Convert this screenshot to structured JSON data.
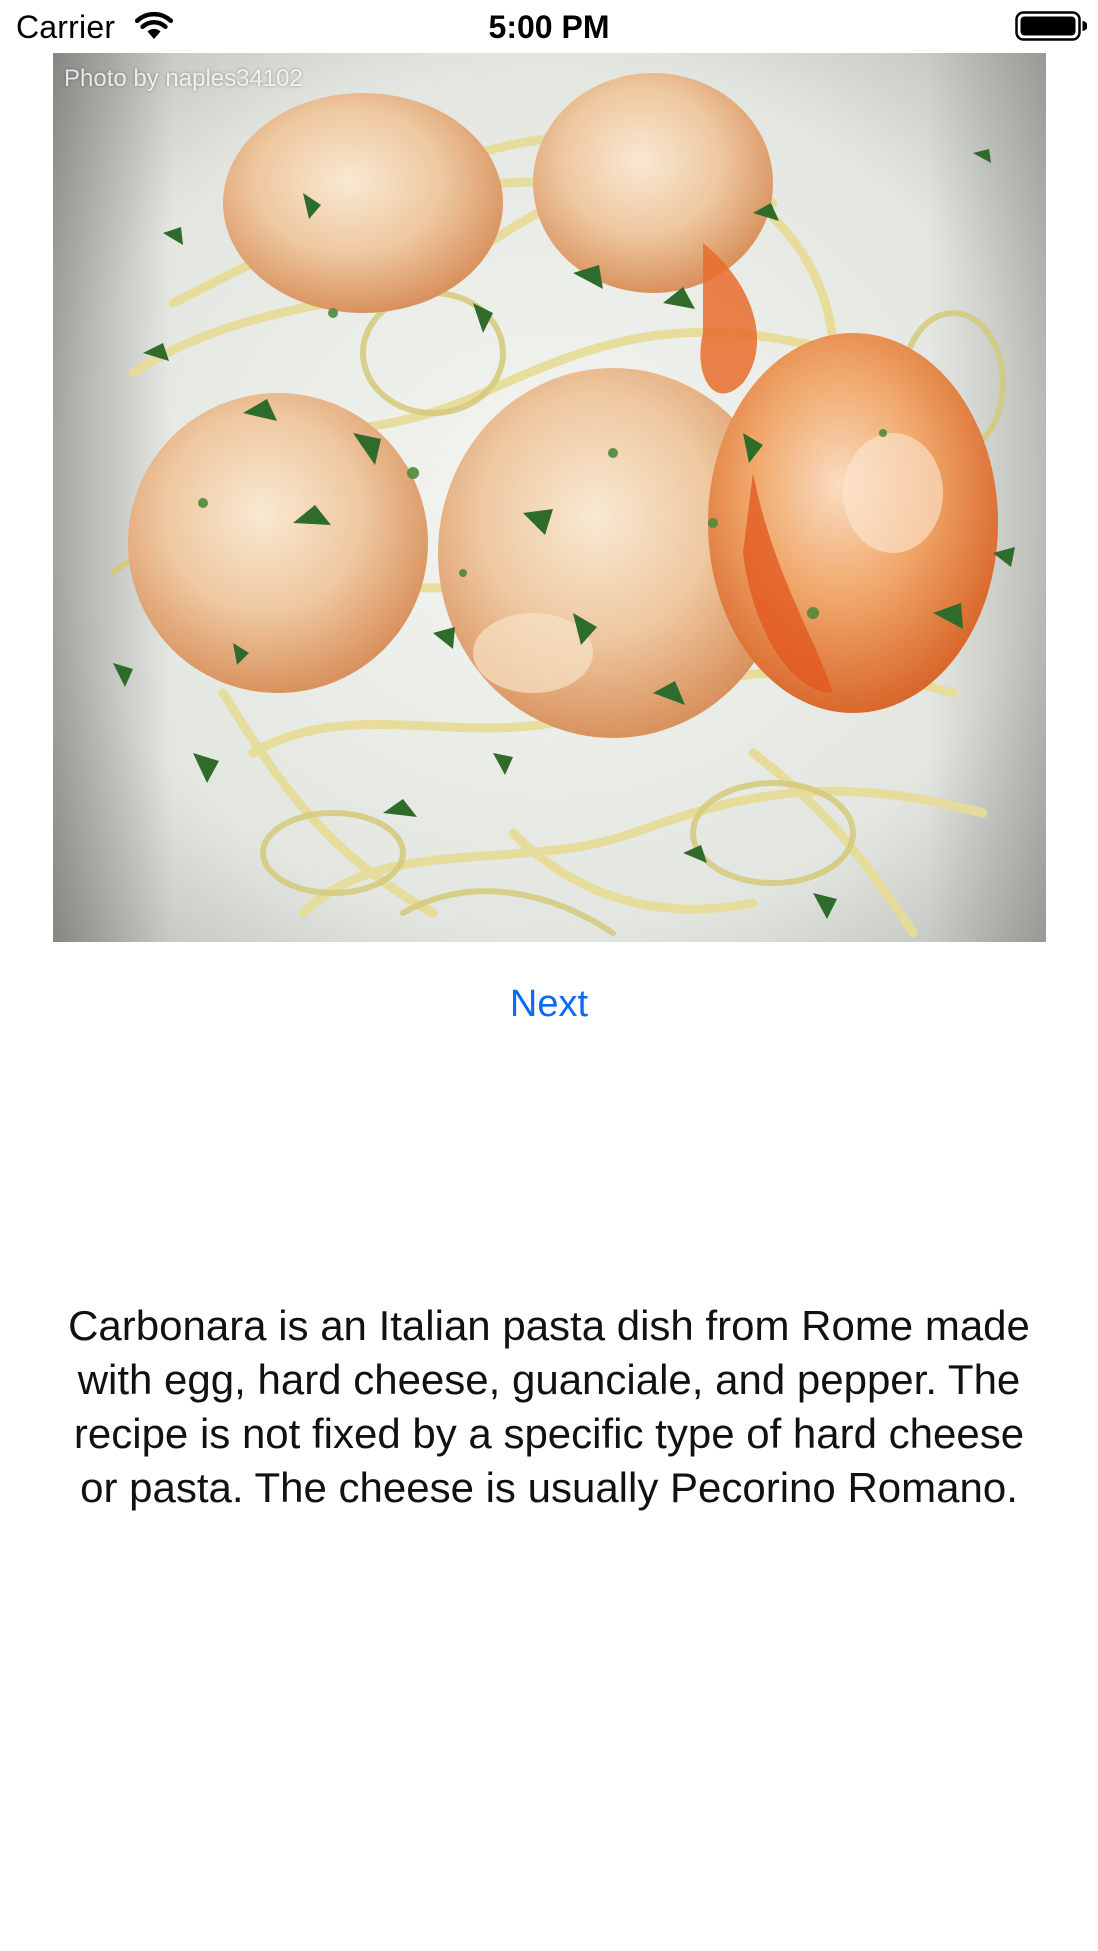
{
  "status_bar": {
    "carrier": "Carrier",
    "time": "5:00 PM",
    "icons": [
      "wifi-icon",
      "battery-icon"
    ]
  },
  "photo": {
    "alt": "Shrimp with linguine",
    "credit": "Photo by naples34102"
  },
  "next_button": {
    "label": "Next"
  },
  "description": {
    "text": "Carbonara is an Italian pasta dish from Rome made with egg, hard cheese, guanciale, and pepper. The recipe is not fixed by a specific type of hard cheese or pasta. The cheese is usually Pecorino Romano."
  },
  "colors": {
    "accent": "#0a6cf5",
    "background": "#ffffff",
    "text": "#111111"
  }
}
